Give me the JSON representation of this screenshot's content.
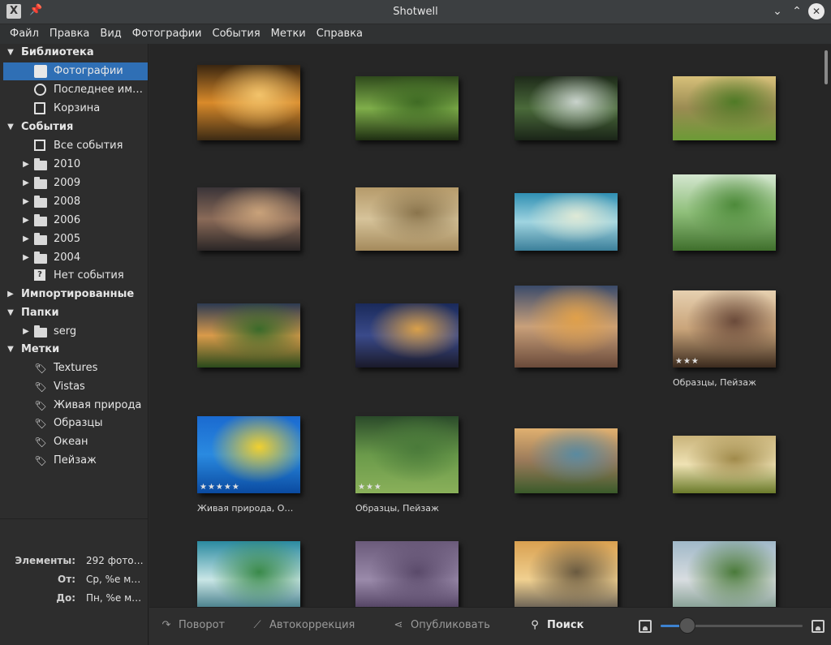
{
  "window": {
    "title": "Shotwell",
    "app_icon": "X"
  },
  "menu": [
    "Файл",
    "Правка",
    "Вид",
    "Фотографии",
    "События",
    "Метки",
    "Справка"
  ],
  "sidebar": {
    "library": "Библиотека",
    "photos": "Фотографии",
    "recent": "Последнее им…",
    "trash": "Корзина",
    "events": "События",
    "all_events": "Все события",
    "years": [
      "2010",
      "2009",
      "2008",
      "2006",
      "2005",
      "2004"
    ],
    "no_event": "Нет события",
    "imported": "Импортированные",
    "folders": "Папки",
    "folder_serg": "serg",
    "tags": "Метки",
    "tag_items": [
      "Textures",
      "Vistas",
      "Живая природа",
      "Образцы",
      "Океан",
      "Пейзаж"
    ]
  },
  "info": {
    "items_label": "Элементы:",
    "items_value": "292 фото…",
    "from_label": "От:",
    "from_value": "Ср, %e м…",
    "to_label": "До:",
    "to_value": "Пн, %e м…"
  },
  "photos": [
    {
      "name": "sunset-clouds",
      "colors": [
        "#3a2610",
        "#d98a2a",
        "#f2c36b",
        "#3c2a14"
      ]
    },
    {
      "name": "green-grass",
      "colors": [
        "#2f4a1c",
        "#7fae4a",
        "#3f6b24",
        "#1e2e12"
      ]
    },
    {
      "name": "forest-stream",
      "colors": [
        "#1e2a1a",
        "#4a6a3a",
        "#c9d3cc",
        "#1a2418"
      ]
    },
    {
      "name": "field-house",
      "colors": [
        "#d7c07a",
        "#9a8b52",
        "#4f7a26",
        "#6c9a36"
      ]
    },
    {
      "name": "lake-dusk",
      "colors": [
        "#3a3438",
        "#8a6a58",
        "#c9a27a",
        "#2a2626"
      ]
    },
    {
      "name": "wheat-poppy",
      "colors": [
        "#b59a6a",
        "#d6c39a",
        "#8a744c",
        "#a48a5c"
      ]
    },
    {
      "name": "sky-clouds",
      "colors": [
        "#2f8fb3",
        "#9fd4e0",
        "#dfe9d6",
        "#3b7f9a"
      ]
    },
    {
      "name": "green-hills",
      "colors": [
        "#d4e6d0",
        "#8fbf7a",
        "#4d8a3a",
        "#3f6f2c"
      ]
    },
    {
      "name": "valley-sunset",
      "colors": [
        "#2c3a52",
        "#d99a4a",
        "#3a6a2a",
        "#2a4a1c"
      ]
    },
    {
      "name": "night-city",
      "colors": [
        "#1a2a5a",
        "#3a4a8a",
        "#d9a04a",
        "#1a1a2a"
      ]
    },
    {
      "name": "ship-sunset",
      "colors": [
        "#3a4a6a",
        "#c9a07a",
        "#e0a04a",
        "#6a4a3a"
      ]
    },
    {
      "name": "trees-fog",
      "colors": [
        "#e6d0b0",
        "#c9a47a",
        "#6a4a3a",
        "#3a2a1e"
      ]
    },
    {
      "name": "sea-turtle",
      "colors": [
        "#1a6ad0",
        "#2a8ae0",
        "#f0d030",
        "#0a4aa0"
      ]
    },
    {
      "name": "forest-road",
      "colors": [
        "#2a4a2a",
        "#6a9a4a",
        "#4a7a3a",
        "#8ab05a"
      ]
    },
    {
      "name": "river-valley",
      "colors": [
        "#e0b070",
        "#9a7a5a",
        "#5a8aa0",
        "#3a5a2a"
      ]
    },
    {
      "name": "tree-horizon",
      "colors": [
        "#c9b37a",
        "#efe2b4",
        "#a08a4a",
        "#6a7a2a"
      ]
    },
    {
      "name": "waterfall",
      "colors": [
        "#2a8aa0",
        "#c9e6e6",
        "#3a8a4a",
        "#1a5a6a"
      ]
    },
    {
      "name": "purple-sea",
      "colors": [
        "#6a5a7a",
        "#9a8aaa",
        "#5a4a6a",
        "#3a2a4a"
      ]
    },
    {
      "name": "taj-mahal-sunset",
      "colors": [
        "#d9a050",
        "#f0d090",
        "#6a5a40",
        "#3a3a40"
      ]
    },
    {
      "name": "taj-mahal-day",
      "colors": [
        "#a0b8c8",
        "#d8dde0",
        "#4a7a3a",
        "#6a8a7a"
      ]
    }
  ],
  "ratings": {
    "photo12": "★★★",
    "photo13": "★★★★★",
    "photo14": "★★★"
  },
  "captions": {
    "photo12": "Образцы, Пейзаж",
    "photo13": "Живая природа, О…",
    "photo14": "Образцы, Пейзаж"
  },
  "toolbar": {
    "rotate": "Поворот",
    "enhance": "Автокоррекция",
    "publish": "Опубликовать",
    "search": "Поиск",
    "zoom_level": 0.19
  }
}
